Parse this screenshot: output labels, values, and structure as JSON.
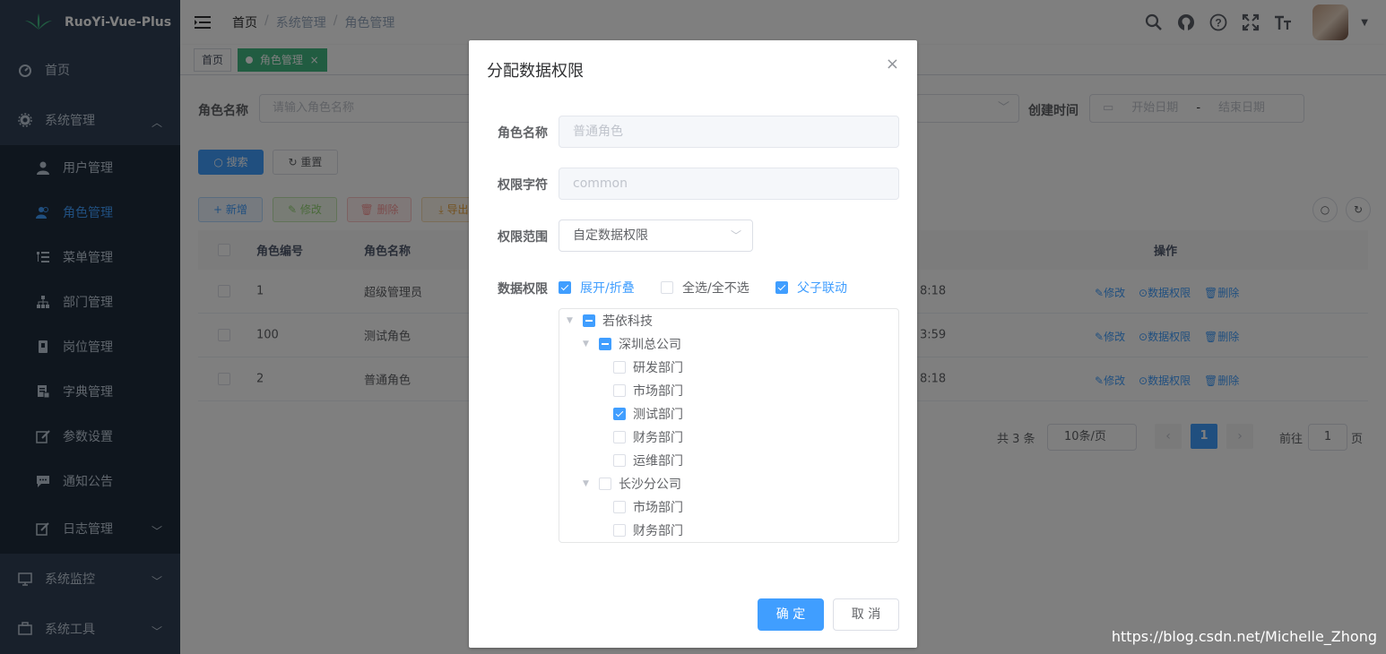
{
  "app": {
    "title": "RuoYi-Vue-Plus"
  },
  "sidebar": {
    "items": [
      {
        "label": "首页"
      },
      {
        "label": "系统管理"
      },
      {
        "label": "用户管理"
      },
      {
        "label": "角色管理"
      },
      {
        "label": "菜单管理"
      },
      {
        "label": "部门管理"
      },
      {
        "label": "岗位管理"
      },
      {
        "label": "字典管理"
      },
      {
        "label": "参数设置"
      },
      {
        "label": "通知公告"
      },
      {
        "label": "日志管理"
      },
      {
        "label": "系统监控"
      },
      {
        "label": "系统工具"
      }
    ]
  },
  "breadcrumb": {
    "items": [
      "首页",
      "系统管理",
      "角色管理"
    ],
    "sep": "/"
  },
  "tags": {
    "home": "首页",
    "current": "角色管理",
    "close": "×"
  },
  "search": {
    "role_name_label": "角色名称",
    "role_name_placeholder": "请输入角色名称",
    "created_label": "创建时间",
    "start_placeholder": "开始日期",
    "range_sep": "-",
    "end_placeholder": "结束日期",
    "search_btn": "搜索",
    "reset_btn": "重置"
  },
  "toolbar": {
    "add": "新增",
    "edit": "修改",
    "delete": "删除",
    "export": "导出"
  },
  "table": {
    "headers": {
      "id": "角色编号",
      "name": "角色名称",
      "ops": "操作"
    },
    "rows": [
      {
        "id": "1",
        "name": "超级管理员",
        "time": "8:18"
      },
      {
        "id": "100",
        "name": "测试角色",
        "time": "3:59"
      },
      {
        "id": "2",
        "name": "普通角色",
        "time": "8:18"
      }
    ],
    "op_edit": "修改",
    "op_scope": "数据权限",
    "op_delete": "删除"
  },
  "pagination": {
    "total": "共 3 条",
    "size": "10条/页",
    "page": "1",
    "goto": "前往",
    "goto_value": "1",
    "page_unit": "页"
  },
  "dialog": {
    "title": "分配数据权限",
    "close": "×",
    "role_name_label": "角色名称",
    "role_name_value": "普通角色",
    "perm_label": "权限字符",
    "perm_value": "common",
    "scope_label": "权限范围",
    "scope_value": "自定数据权限",
    "data_label": "数据权限",
    "opt_expand": "展开/折叠",
    "opt_all": "全选/全不选",
    "opt_link": "父子联动",
    "tree": [
      {
        "label": "若依科技"
      },
      {
        "label": "深圳总公司"
      },
      {
        "label": "研发部门"
      },
      {
        "label": "市场部门"
      },
      {
        "label": "测试部门"
      },
      {
        "label": "财务部门"
      },
      {
        "label": "运维部门"
      },
      {
        "label": "长沙分公司"
      },
      {
        "label": "市场部门"
      },
      {
        "label": "财务部门"
      }
    ],
    "confirm": "确 定",
    "cancel": "取 消"
  },
  "watermark": "https://blog.csdn.net/Michelle_Zhong",
  "colors": {
    "primary": "#409eff",
    "sidebar": "#304156",
    "tag_active": "#42b983"
  }
}
